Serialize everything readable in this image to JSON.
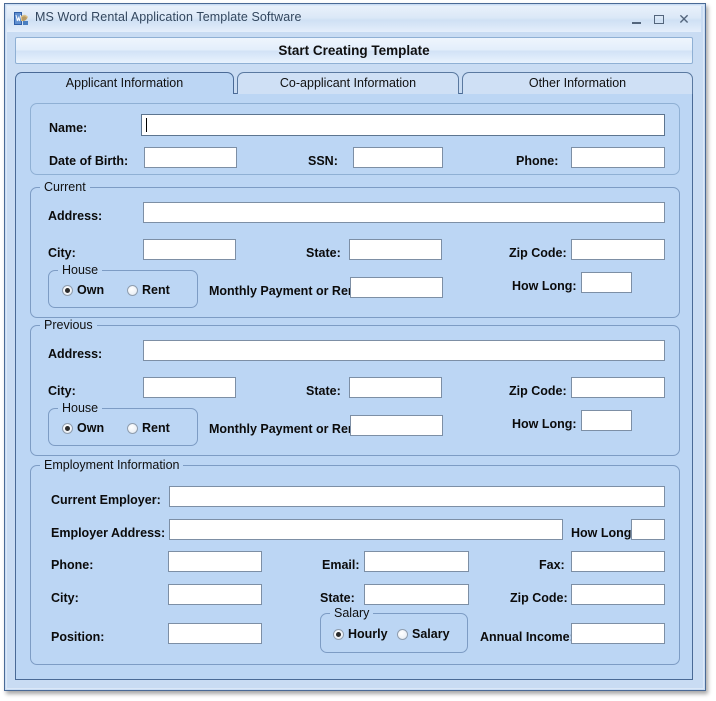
{
  "window": {
    "title": "MS Word Rental Application Template Software",
    "icon": "app-icon",
    "controls": {
      "minimize": "minimize-icon",
      "maximize": "maximize-icon",
      "close": "✕"
    }
  },
  "toolbar": {
    "start_label": "Start Creating Template"
  },
  "tabs": [
    {
      "label": "Applicant Information",
      "selected": true
    },
    {
      "label": "Co-applicant Information",
      "selected": false
    },
    {
      "label": "Other Information",
      "selected": false
    }
  ],
  "applicant": {
    "personal": {
      "name_label": "Name:",
      "name_value": "",
      "dob_label": "Date of Birth:",
      "dob_value": "",
      "ssn_label": "SSN:",
      "ssn_value": "",
      "phone_label": "Phone:",
      "phone_value": ""
    },
    "current": {
      "group_label": "Current",
      "address_label": "Address:",
      "address_value": "",
      "city_label": "City:",
      "city_value": "",
      "state_label": "State:",
      "state_value": "",
      "zip_label": "Zip Code:",
      "zip_value": "",
      "house_group_label": "House",
      "own_label": "Own",
      "rent_label": "Rent",
      "house_selected": "Own",
      "payment_label": "Monthly Payment or Rent:",
      "payment_value": "",
      "how_long_label": "How Long:",
      "how_long_value": ""
    },
    "previous": {
      "group_label": "Previous",
      "address_label": "Address:",
      "address_value": "",
      "city_label": "City:",
      "city_value": "",
      "state_label": "State:",
      "state_value": "",
      "zip_label": "Zip Code:",
      "zip_value": "",
      "house_group_label": "House",
      "own_label": "Own",
      "rent_label": "Rent",
      "house_selected": "Own",
      "payment_label": "Monthly Payment or Rent:",
      "payment_value": "",
      "how_long_label": "How Long:",
      "how_long_value": ""
    },
    "employment": {
      "group_label": "Employment Information",
      "employer_label": "Current Employer:",
      "employer_value": "",
      "employer_address_label": "Employer Address:",
      "employer_address_value": "",
      "how_long_label": "How Long:",
      "how_long_value": "",
      "phone_label": "Phone:",
      "phone_value": "",
      "email_label": "Email:",
      "email_value": "",
      "fax_label": "Fax:",
      "fax_value": "",
      "city_label": "City:",
      "city_value": "",
      "state_label": "State:",
      "state_value": "",
      "zip_label": "Zip Code:",
      "zip_value": "",
      "position_label": "Position:",
      "position_value": "",
      "salary_group_label": "Salary",
      "hourly_label": "Hourly",
      "salary_label": "Salary",
      "salary_selected": "Hourly",
      "annual_income_label": "Annual Income:",
      "annual_income_value": ""
    }
  },
  "colors": {
    "window_frame": "#4a6a96",
    "panel_bg": "#bcd6f4",
    "client_bg": "#c9dcf3",
    "field_bg": "#ffffff",
    "field_border": "#7d8fa5",
    "group_border": "#7d9cc4",
    "text": "#0b0b0b"
  }
}
